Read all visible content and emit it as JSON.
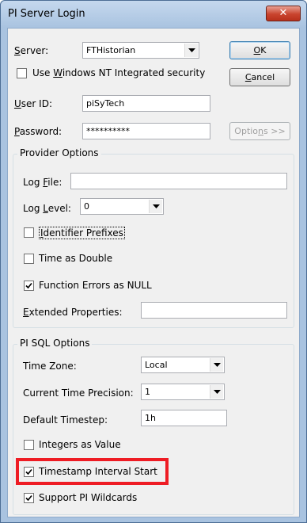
{
  "window": {
    "title": "PI Server Login",
    "close_glyph": "✕"
  },
  "login": {
    "server_label": "Server:",
    "server_value": "FTHistorian",
    "nt_security_label": "Use Windows NT Integrated security",
    "nt_security_checked": false,
    "userid_label": "User ID:",
    "userid_value": "piSyTech",
    "password_label": "Password:",
    "password_value": "**********"
  },
  "buttons": {
    "ok": "OK",
    "cancel": "Cancel",
    "options": "Options >>"
  },
  "provider_options": {
    "title": "Provider Options",
    "log_file_label": "Log File:",
    "log_file_value": "",
    "log_level_label": "Log Level:",
    "log_level_value": "0",
    "identifier_prefixes_label": "Identifier Prefixes",
    "identifier_prefixes_checked": false,
    "time_as_double_label": "Time as Double",
    "time_as_double_checked": false,
    "function_errors_label": "Function Errors as NULL",
    "function_errors_checked": true,
    "extended_properties_label": "Extended Properties:",
    "extended_properties_value": ""
  },
  "pisql_options": {
    "title": "PI SQL Options",
    "time_zone_label": "Time Zone:",
    "time_zone_value": "Local",
    "precision_label": "Current Time Precision:",
    "precision_value": "1",
    "timestep_label": "Default Timestep:",
    "timestep_value": "1h",
    "integers_label": "Integers as Value",
    "integers_checked": false,
    "timestamp_label": "Timestamp Interval Start",
    "timestamp_checked": true,
    "wildcards_label": "Support PI Wildcards",
    "wildcards_checked": true
  },
  "colors": {
    "highlight": "#ee1c24",
    "titlebar": "#a9c3e0",
    "close": "#c9442e"
  }
}
